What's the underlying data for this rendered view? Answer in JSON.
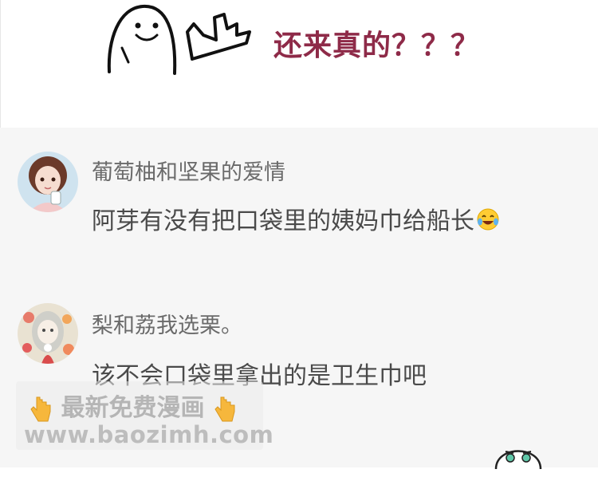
{
  "header": {
    "headline": "还来真的？？？",
    "meme_icon": "ghost-pointing-icon"
  },
  "comments": [
    {
      "username": "葡萄柚和坚果的爱情",
      "text": "阿芽有没有把口袋里的姨妈巾给船长",
      "emoji": "laughing-tears-emoji",
      "avatar": "girl-avatar-pink"
    },
    {
      "username": "梨和荔我选栗。",
      "text": "该不会口袋里拿出的是卫生巾吧",
      "avatar": "girl-avatar-flowers"
    }
  ],
  "watermark": {
    "line1": "最新免费漫画",
    "line2": "www.baozimh.com",
    "hand_icon": "pointing-down-hand-icon"
  },
  "colors": {
    "headline": "#8e2a48",
    "username": "#6a6a6a",
    "comment": "#4a4a4a",
    "comment_bg": "#f6f6f6"
  }
}
